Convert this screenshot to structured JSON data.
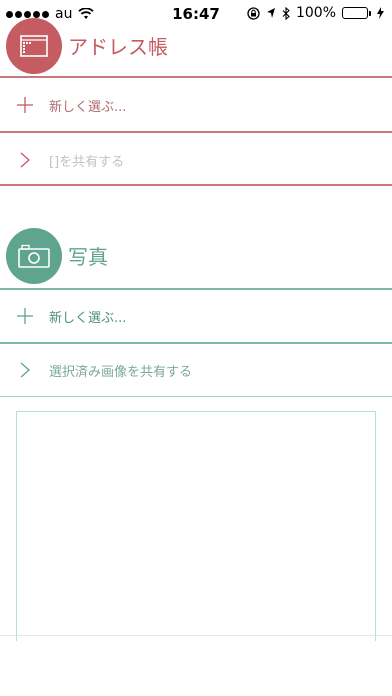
{
  "status_bar": {
    "carrier": "au",
    "time": "16:47",
    "battery": "100%"
  },
  "address_section": {
    "title": "アドレス帳",
    "new_select_label": "新しく選ぶ...",
    "share_label": "[]を共有する",
    "accent_color": "#c45c62"
  },
  "photo_section": {
    "title": "写真",
    "new_select_label": "新しく選ぶ...",
    "share_label": "選択済み画像を共有する",
    "accent_color": "#5fa48e"
  },
  "icons": {
    "address": "address-book-icon",
    "photo": "camera-icon",
    "add": "plus-icon",
    "share": "chevron-right-icon"
  }
}
